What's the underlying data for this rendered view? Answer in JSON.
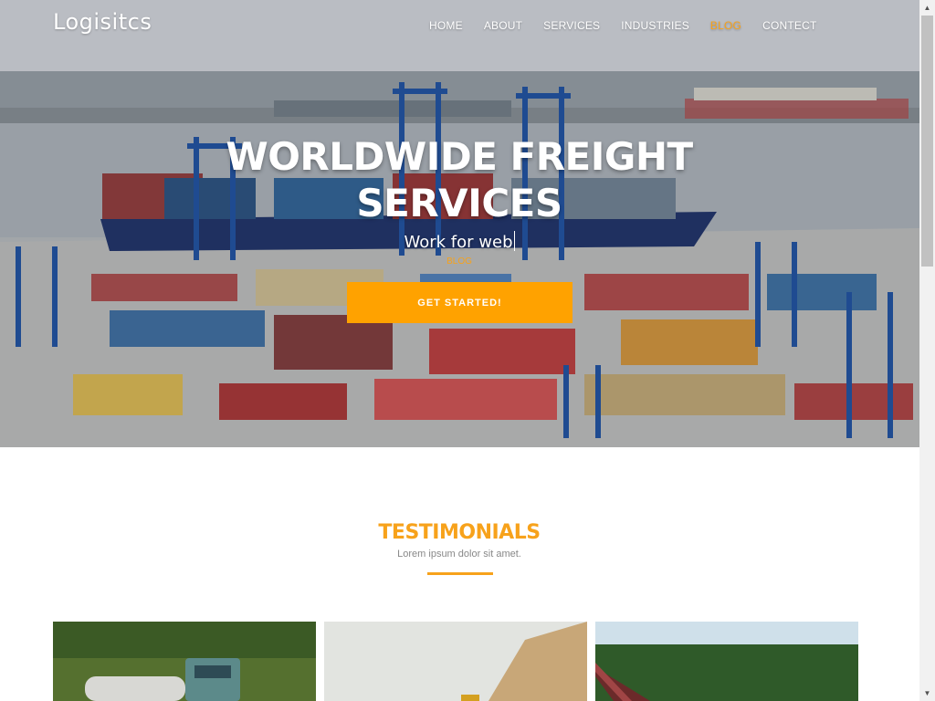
{
  "brand": {
    "name": "Logisitcs",
    "accent": "#f7a21b",
    "button": "#ffa200"
  },
  "nav": [
    {
      "label": "HOME",
      "active": false
    },
    {
      "label": "ABOUT",
      "active": false
    },
    {
      "label": "SERVICES",
      "active": false
    },
    {
      "label": "INDUSTRIES",
      "active": false
    },
    {
      "label": "BLOG",
      "active": true
    },
    {
      "label": "CONTECT",
      "active": false
    }
  ],
  "hero": {
    "headline_line1": "WORLDWIDE FREIGHT",
    "headline_line2": "SERVICES",
    "typed_text": "Work for web",
    "breadcrumb": "BLOG",
    "cta_label": "GET STARTED!"
  },
  "testimonials": {
    "title": "TESTIMONIALS",
    "subtitle": "Lorem ipsum dolor sit amet."
  },
  "icons": {
    "scroll_up": "triangle-up",
    "scroll_down": "triangle-down"
  }
}
